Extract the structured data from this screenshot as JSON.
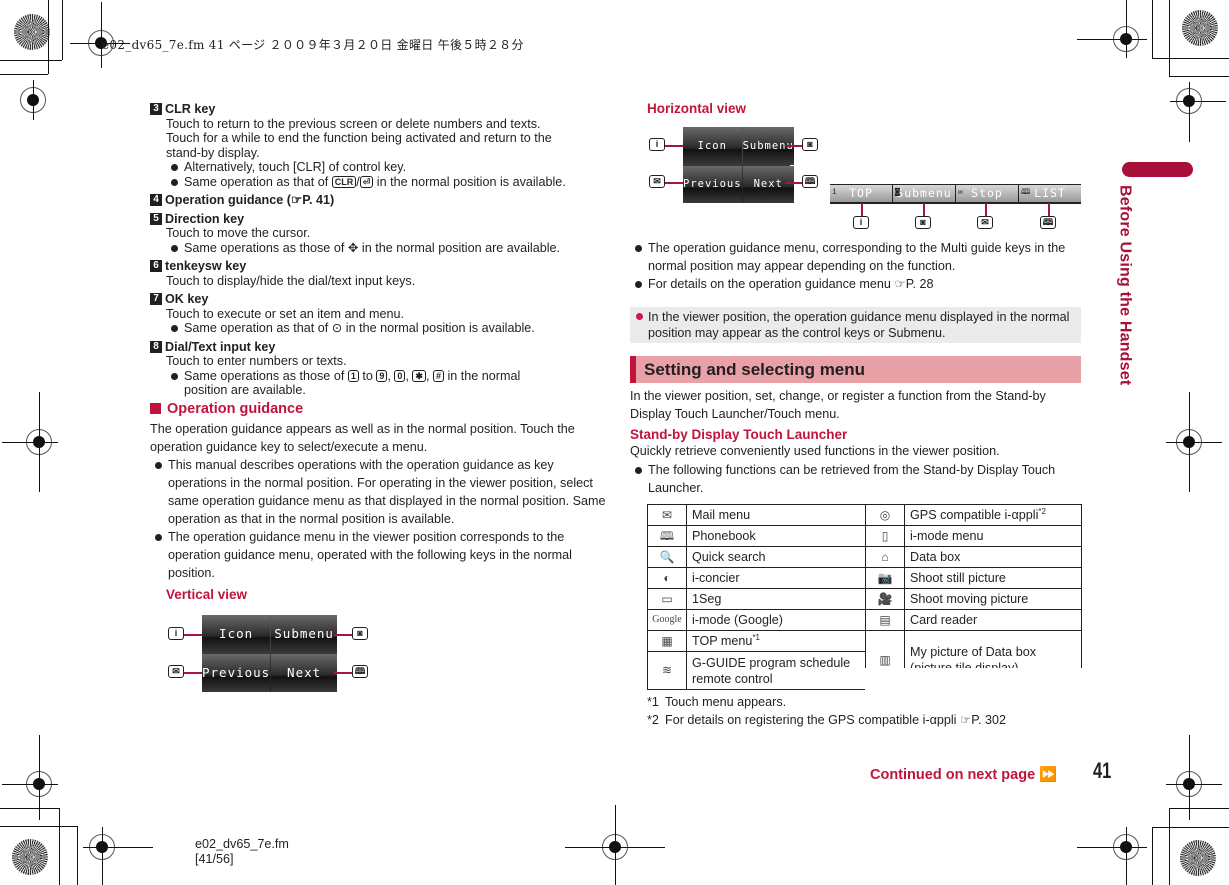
{
  "print_header": "e02_dv65_7e.fm  41 ページ  ２００９年３月２０日  金曜日  午後５時２８分",
  "left": {
    "keys": [
      {
        "num": "3",
        "title": "CLR key",
        "lines": [
          "Touch to return to the previous screen or delete numbers and texts.",
          "Touch for a while to end the function being activated and return to the",
          "stand-by display."
        ],
        "bullets": [
          {
            "text": "Alternatively, touch [CLR] of control key."
          },
          {
            "pre": "Same operation as that of ",
            "key1": "CLR",
            "sep": "/",
            "key2": "⏎",
            "post": " in the normal position is available."
          }
        ]
      },
      {
        "num": "4",
        "title": "Operation guidance (☞P. 41)"
      },
      {
        "num": "5",
        "title": "Direction key",
        "lines": [
          "Touch to move the cursor."
        ],
        "bullets": [
          {
            "pre": "Same operations as those of ",
            "key1": "✥",
            "post": " in the normal position are available."
          }
        ]
      },
      {
        "num": "6",
        "title": "tenkeysw key",
        "lines": [
          "Touch to display/hide the dial/text input keys."
        ]
      },
      {
        "num": "7",
        "title": "OK key",
        "lines": [
          "Touch to execute or set an item and menu."
        ],
        "bullets": [
          {
            "pre": "Same operation as that of ",
            "key1": "⊙",
            "post": " in the normal position is available."
          }
        ]
      },
      {
        "num": "8",
        "title": "Dial/Text input key",
        "lines": [
          "Touch to enter numbers or texts."
        ],
        "bullets": [
          {
            "pre": "Same operations as those of ",
            "k1": "1",
            "to": " to ",
            "k2": "9",
            "c1": ", ",
            "k3": "0",
            "c2": ", ",
            "k4": "✱",
            "c3": ", ",
            "k5": "#",
            "post": " in the normal",
            "post2": "position are available."
          }
        ]
      }
    ],
    "operation_guidance": {
      "heading": "Operation guidance",
      "intro": "The operation guidance appears as well as in the normal position. Touch the operation guidance key to select/execute a menu.",
      "bullets": [
        "This manual describes operations with the operation guidance as key operations in the normal position. For operating in the viewer position, select same operation guidance menu as that displayed in the normal position. Same operation as that in the normal position is available.",
        "The operation guidance menu in the viewer position corresponds to the operation guidance menu, operated with the following keys in the normal position."
      ],
      "vertical_view_label": "Vertical view",
      "vertical_screen": [
        "Icon",
        "Submenu",
        "Previous",
        "Next"
      ]
    }
  },
  "right": {
    "horizontal_view_label": "Horizontal view",
    "horizontal_screen": [
      "Icon",
      "Submenu",
      "Previous",
      "Next"
    ],
    "horizontal_bar": [
      "TOP",
      "Submenu",
      "Stop",
      "LIST"
    ],
    "bullets": [
      "The operation guidance menu, corresponding to the Multi guide keys in the normal position may appear depending on the function.",
      "For details on the operation guidance menu ☞P. 28"
    ],
    "note": "In the viewer position, the operation guidance menu displayed in the normal position may appear as the control keys or Submenu.",
    "section_title": "Setting and selecting menu",
    "section_intro": "In the viewer position, set, change, or register a function from the Stand-by Display Touch Launcher/Touch menu.",
    "launcher_heading": "Stand-by Display Touch Launcher",
    "launcher_intro": "Quickly retrieve conveniently used functions in the viewer position.",
    "launcher_bullet": "The following functions can be retrieved from the Stand-by Display Touch Launcher.",
    "table_left": [
      {
        "icon": "✉",
        "label": "Mail menu"
      },
      {
        "icon": "🕮",
        "label": "Phonebook"
      },
      {
        "icon": "🔍",
        "label": "Quick search"
      },
      {
        "icon": "◐",
        "label": "i-concier"
      },
      {
        "icon": "▭",
        "label": "1Seg"
      },
      {
        "icon": "Google",
        "label": "i-mode (Google)"
      },
      {
        "icon": "▦",
        "label": "TOP menu",
        "sup": "*1"
      },
      {
        "icon": "≋",
        "label": "G-GUIDE program schedule remote control"
      }
    ],
    "table_right": [
      {
        "icon": "◎",
        "label": "GPS compatible i-αppli",
        "sup": "*2"
      },
      {
        "icon": "▯",
        "label": "i-mode menu"
      },
      {
        "icon": "⌂",
        "label": "Data box"
      },
      {
        "icon": "📷",
        "label": "Shoot still picture"
      },
      {
        "icon": "🎥",
        "label": "Shoot moving picture"
      },
      {
        "icon": "▤",
        "label": "Card reader"
      },
      {
        "icon": "▥",
        "label": "My picture of Data box (picture tile display)"
      }
    ],
    "footnotes": [
      {
        "mark": "*1",
        "text": "Touch menu appears."
      },
      {
        "mark": "*2",
        "text": "For details on registering the GPS compatible i-αppli ☞P. 302"
      }
    ]
  },
  "side_tab": "Before Using the Handset",
  "continued": "Continued on next page ⏩",
  "page_number": "41",
  "footer": {
    "file": "e02_dv65_7e.fm",
    "pages": "[41/56]"
  },
  "key_icons": {
    "i": "i",
    "camera": "◙",
    "mail": "✉",
    "book": "🕮"
  }
}
